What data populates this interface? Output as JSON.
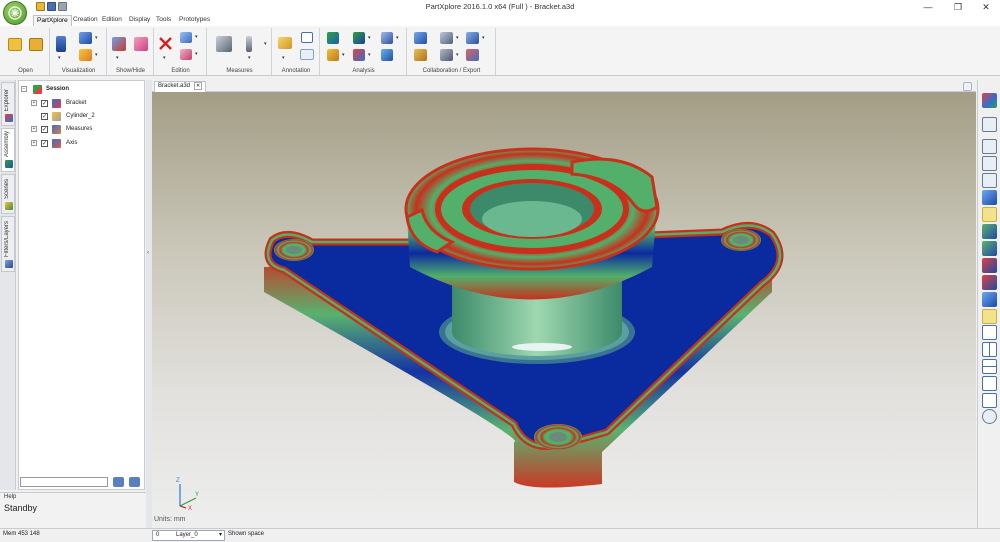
{
  "window": {
    "title": "PartXplore 2016.1.0 x64 (Full ) - Bracket.a3d",
    "minimize_glyph": "—",
    "maximize_glyph": "❐",
    "close_glyph": "✕"
  },
  "tabs": [
    {
      "label": "PartXplore"
    },
    {
      "label": "Creation"
    },
    {
      "label": "Edition"
    },
    {
      "label": "Display"
    },
    {
      "label": "Tools"
    },
    {
      "label": "Prototypes"
    }
  ],
  "ribbon": {
    "groups": [
      {
        "label": "Open"
      },
      {
        "label": "Visualization"
      },
      {
        "label": "Show/Hide"
      },
      {
        "label": "Edition"
      },
      {
        "label": "Measures"
      },
      {
        "label": "Annotation"
      },
      {
        "label": "Analysis"
      },
      {
        "label": "Collaboration / Export"
      }
    ]
  },
  "side_tabs": [
    {
      "label": "Explorer"
    },
    {
      "label": "Assembly"
    },
    {
      "label": "Scenes"
    },
    {
      "label": "Filters/Layers"
    }
  ],
  "tree": {
    "root": "Session",
    "nodes": [
      {
        "label": "Bracket"
      },
      {
        "label": "Cylinder_2"
      },
      {
        "label": "Measures"
      },
      {
        "label": "Axis"
      }
    ]
  },
  "help": {
    "title": "Help",
    "text": "Standby"
  },
  "document": {
    "tab": "Bracket.a3d",
    "units": "Units: mm",
    "axes": {
      "x": "X",
      "y": "Y",
      "z": "Z"
    }
  },
  "status": {
    "memory": "Mem 453 148",
    "field_value": "0",
    "layer": "Layer_0",
    "space": "Shown space"
  },
  "colors": {
    "accent": "#2b5fa8",
    "model_blue": "#0a2aa0",
    "model_green": "#52b06a",
    "model_red": "#c8301c"
  }
}
